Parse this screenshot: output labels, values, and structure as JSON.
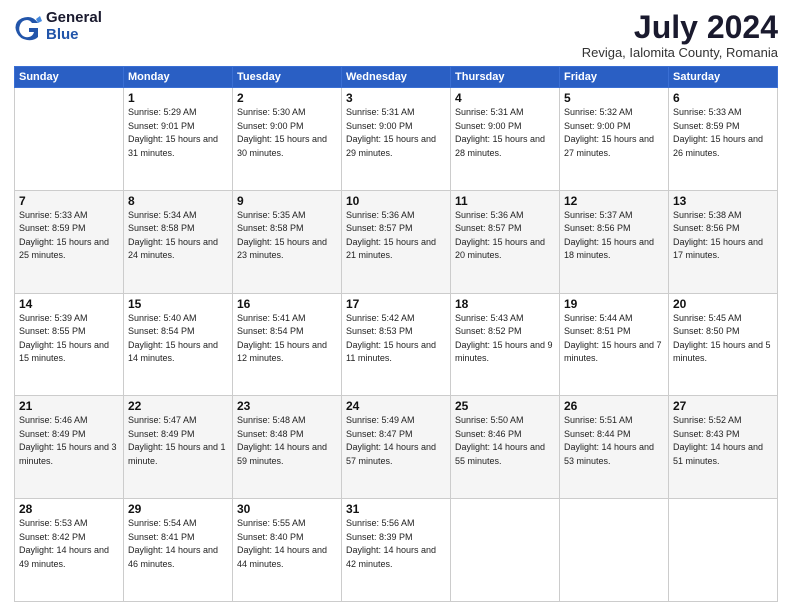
{
  "logo": {
    "general": "General",
    "blue": "Blue"
  },
  "title": {
    "month_year": "July 2024",
    "location": "Reviga, Ialomita County, Romania"
  },
  "weekdays": [
    "Sunday",
    "Monday",
    "Tuesday",
    "Wednesday",
    "Thursday",
    "Friday",
    "Saturday"
  ],
  "weeks": [
    [
      {
        "day": "",
        "sunrise": "",
        "sunset": "",
        "daylight": ""
      },
      {
        "day": "1",
        "sunrise": "Sunrise: 5:29 AM",
        "sunset": "Sunset: 9:01 PM",
        "daylight": "Daylight: 15 hours and 31 minutes."
      },
      {
        "day": "2",
        "sunrise": "Sunrise: 5:30 AM",
        "sunset": "Sunset: 9:00 PM",
        "daylight": "Daylight: 15 hours and 30 minutes."
      },
      {
        "day": "3",
        "sunrise": "Sunrise: 5:31 AM",
        "sunset": "Sunset: 9:00 PM",
        "daylight": "Daylight: 15 hours and 29 minutes."
      },
      {
        "day": "4",
        "sunrise": "Sunrise: 5:31 AM",
        "sunset": "Sunset: 9:00 PM",
        "daylight": "Daylight: 15 hours and 28 minutes."
      },
      {
        "day": "5",
        "sunrise": "Sunrise: 5:32 AM",
        "sunset": "Sunset: 9:00 PM",
        "daylight": "Daylight: 15 hours and 27 minutes."
      },
      {
        "day": "6",
        "sunrise": "Sunrise: 5:33 AM",
        "sunset": "Sunset: 8:59 PM",
        "daylight": "Daylight: 15 hours and 26 minutes."
      }
    ],
    [
      {
        "day": "7",
        "sunrise": "Sunrise: 5:33 AM",
        "sunset": "Sunset: 8:59 PM",
        "daylight": "Daylight: 15 hours and 25 minutes."
      },
      {
        "day": "8",
        "sunrise": "Sunrise: 5:34 AM",
        "sunset": "Sunset: 8:58 PM",
        "daylight": "Daylight: 15 hours and 24 minutes."
      },
      {
        "day": "9",
        "sunrise": "Sunrise: 5:35 AM",
        "sunset": "Sunset: 8:58 PM",
        "daylight": "Daylight: 15 hours and 23 minutes."
      },
      {
        "day": "10",
        "sunrise": "Sunrise: 5:36 AM",
        "sunset": "Sunset: 8:57 PM",
        "daylight": "Daylight: 15 hours and 21 minutes."
      },
      {
        "day": "11",
        "sunrise": "Sunrise: 5:36 AM",
        "sunset": "Sunset: 8:57 PM",
        "daylight": "Daylight: 15 hours and 20 minutes."
      },
      {
        "day": "12",
        "sunrise": "Sunrise: 5:37 AM",
        "sunset": "Sunset: 8:56 PM",
        "daylight": "Daylight: 15 hours and 18 minutes."
      },
      {
        "day": "13",
        "sunrise": "Sunrise: 5:38 AM",
        "sunset": "Sunset: 8:56 PM",
        "daylight": "Daylight: 15 hours and 17 minutes."
      }
    ],
    [
      {
        "day": "14",
        "sunrise": "Sunrise: 5:39 AM",
        "sunset": "Sunset: 8:55 PM",
        "daylight": "Daylight: 15 hours and 15 minutes."
      },
      {
        "day": "15",
        "sunrise": "Sunrise: 5:40 AM",
        "sunset": "Sunset: 8:54 PM",
        "daylight": "Daylight: 15 hours and 14 minutes."
      },
      {
        "day": "16",
        "sunrise": "Sunrise: 5:41 AM",
        "sunset": "Sunset: 8:54 PM",
        "daylight": "Daylight: 15 hours and 12 minutes."
      },
      {
        "day": "17",
        "sunrise": "Sunrise: 5:42 AM",
        "sunset": "Sunset: 8:53 PM",
        "daylight": "Daylight: 15 hours and 11 minutes."
      },
      {
        "day": "18",
        "sunrise": "Sunrise: 5:43 AM",
        "sunset": "Sunset: 8:52 PM",
        "daylight": "Daylight: 15 hours and 9 minutes."
      },
      {
        "day": "19",
        "sunrise": "Sunrise: 5:44 AM",
        "sunset": "Sunset: 8:51 PM",
        "daylight": "Daylight: 15 hours and 7 minutes."
      },
      {
        "day": "20",
        "sunrise": "Sunrise: 5:45 AM",
        "sunset": "Sunset: 8:50 PM",
        "daylight": "Daylight: 15 hours and 5 minutes."
      }
    ],
    [
      {
        "day": "21",
        "sunrise": "Sunrise: 5:46 AM",
        "sunset": "Sunset: 8:49 PM",
        "daylight": "Daylight: 15 hours and 3 minutes."
      },
      {
        "day": "22",
        "sunrise": "Sunrise: 5:47 AM",
        "sunset": "Sunset: 8:49 PM",
        "daylight": "Daylight: 15 hours and 1 minute."
      },
      {
        "day": "23",
        "sunrise": "Sunrise: 5:48 AM",
        "sunset": "Sunset: 8:48 PM",
        "daylight": "Daylight: 14 hours and 59 minutes."
      },
      {
        "day": "24",
        "sunrise": "Sunrise: 5:49 AM",
        "sunset": "Sunset: 8:47 PM",
        "daylight": "Daylight: 14 hours and 57 minutes."
      },
      {
        "day": "25",
        "sunrise": "Sunrise: 5:50 AM",
        "sunset": "Sunset: 8:46 PM",
        "daylight": "Daylight: 14 hours and 55 minutes."
      },
      {
        "day": "26",
        "sunrise": "Sunrise: 5:51 AM",
        "sunset": "Sunset: 8:44 PM",
        "daylight": "Daylight: 14 hours and 53 minutes."
      },
      {
        "day": "27",
        "sunrise": "Sunrise: 5:52 AM",
        "sunset": "Sunset: 8:43 PM",
        "daylight": "Daylight: 14 hours and 51 minutes."
      }
    ],
    [
      {
        "day": "28",
        "sunrise": "Sunrise: 5:53 AM",
        "sunset": "Sunset: 8:42 PM",
        "daylight": "Daylight: 14 hours and 49 minutes."
      },
      {
        "day": "29",
        "sunrise": "Sunrise: 5:54 AM",
        "sunset": "Sunset: 8:41 PM",
        "daylight": "Daylight: 14 hours and 46 minutes."
      },
      {
        "day": "30",
        "sunrise": "Sunrise: 5:55 AM",
        "sunset": "Sunset: 8:40 PM",
        "daylight": "Daylight: 14 hours and 44 minutes."
      },
      {
        "day": "31",
        "sunrise": "Sunrise: 5:56 AM",
        "sunset": "Sunset: 8:39 PM",
        "daylight": "Daylight: 14 hours and 42 minutes."
      },
      {
        "day": "",
        "sunrise": "",
        "sunset": "",
        "daylight": ""
      },
      {
        "day": "",
        "sunrise": "",
        "sunset": "",
        "daylight": ""
      },
      {
        "day": "",
        "sunrise": "",
        "sunset": "",
        "daylight": ""
      }
    ]
  ]
}
